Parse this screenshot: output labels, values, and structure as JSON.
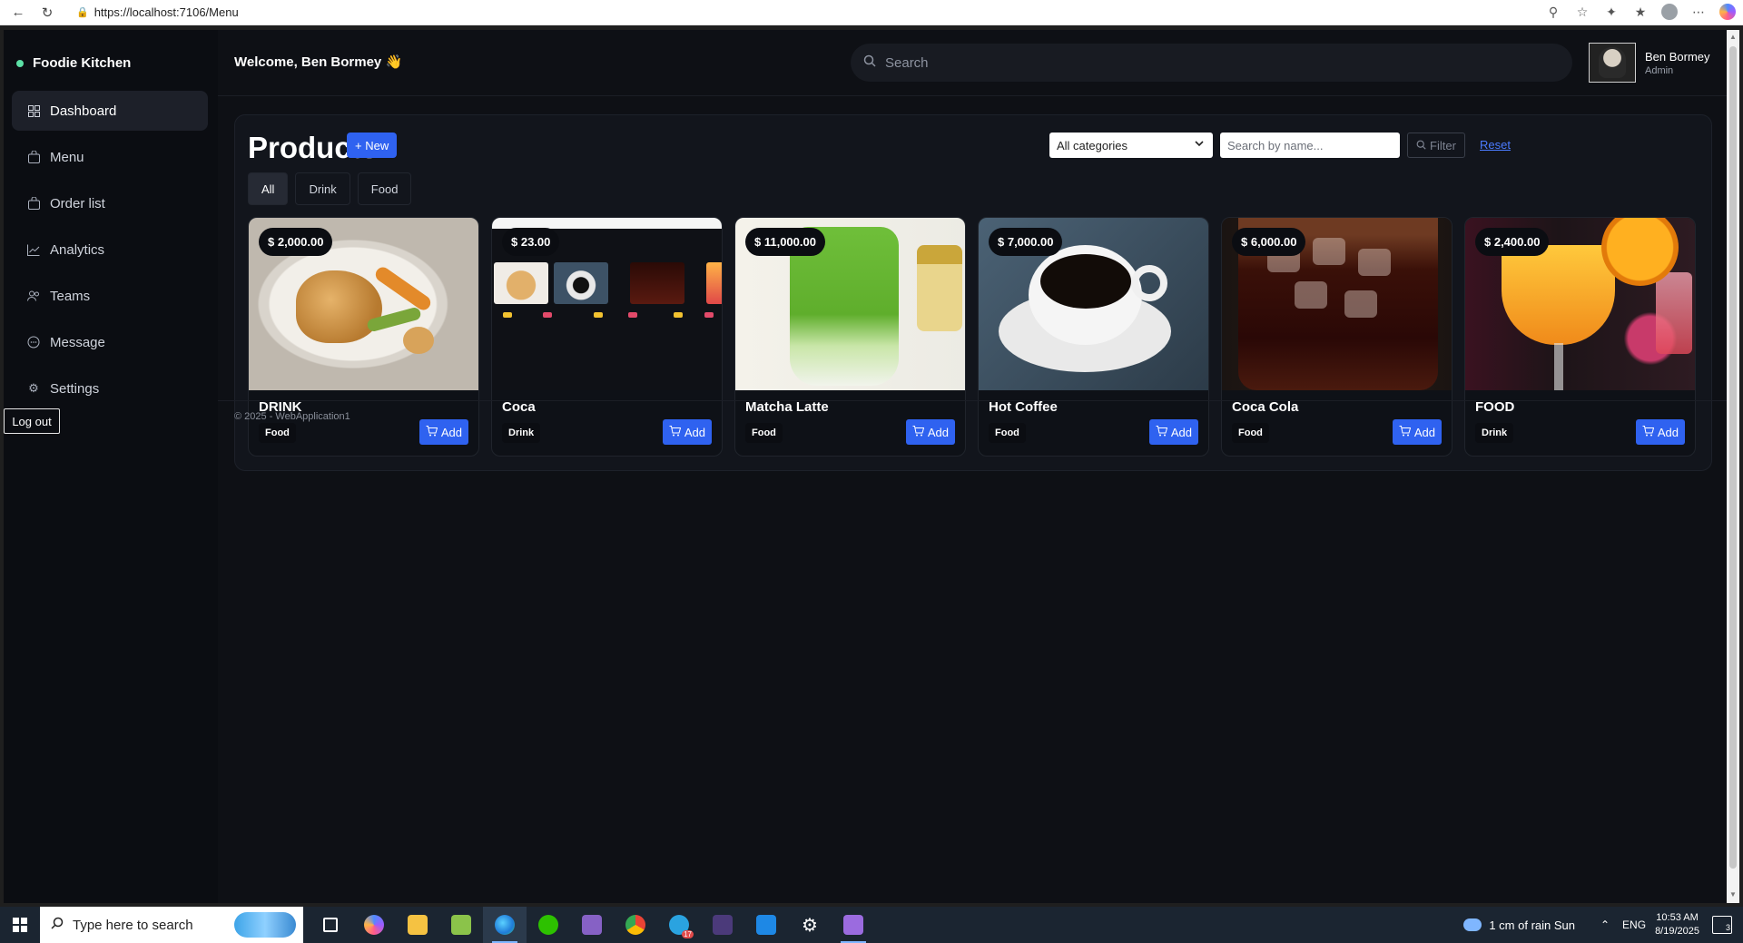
{
  "browser": {
    "url": "https://localhost:7106/Menu"
  },
  "sidebar": {
    "brand": "Foodie Kitchen",
    "items": [
      {
        "label": "Dashboard",
        "icon": "grid-icon",
        "active": true
      },
      {
        "label": "Menu",
        "icon": "bag-icon"
      },
      {
        "label": "Order list",
        "icon": "bag-icon"
      },
      {
        "label": "Analytics",
        "icon": "chart-line-icon"
      },
      {
        "label": "Teams",
        "icon": "users-icon"
      },
      {
        "label": "Message",
        "icon": "chat-icon"
      },
      {
        "label": "Settings",
        "icon": "gear-icon"
      }
    ],
    "logout": "Log out"
  },
  "header": {
    "welcome": "Welcome, Ben Bormey 👋",
    "search_placeholder": "Search",
    "user_name": "Ben Bormey",
    "user_role": "Admin"
  },
  "products": {
    "title": "Products",
    "new_label": "+ New",
    "category_select": "All categories",
    "name_search_placeholder": "Search by name...",
    "filter_label": "Filter",
    "reset_label": "Reset",
    "tabs": [
      {
        "label": "All",
        "active": true
      },
      {
        "label": "Drink"
      },
      {
        "label": "Food"
      }
    ],
    "add_label": "Add",
    "cards": [
      {
        "price": "$ 2,000.00",
        "name": "DRINK",
        "category": "Food"
      },
      {
        "price": "$ 23.00",
        "name": "Coca",
        "category": "Drink"
      },
      {
        "price": "$ 11,000.00",
        "name": "Matcha Latte",
        "category": "Food"
      },
      {
        "price": "$ 7,000.00",
        "name": "Hot Coffee",
        "category": "Food"
      },
      {
        "price": "$ 6,000.00",
        "name": "Coca Cola",
        "category": "Food"
      },
      {
        "price": "$ 2,400.00",
        "name": "FOOD",
        "category": "Drink"
      }
    ]
  },
  "footer": {
    "text": "© 2025 - WebApplication1"
  },
  "taskbar": {
    "search_placeholder": "Type here to search",
    "weather": "1 cm of rain Sun",
    "language": "ENG",
    "time": "10:53 AM",
    "date": "8/19/2025",
    "notification_count": "3",
    "telegram_badge": "17"
  },
  "colors": {
    "accent": "#2f62f0",
    "background": "#0e1015",
    "brand_dot": "#5ce0a6"
  }
}
